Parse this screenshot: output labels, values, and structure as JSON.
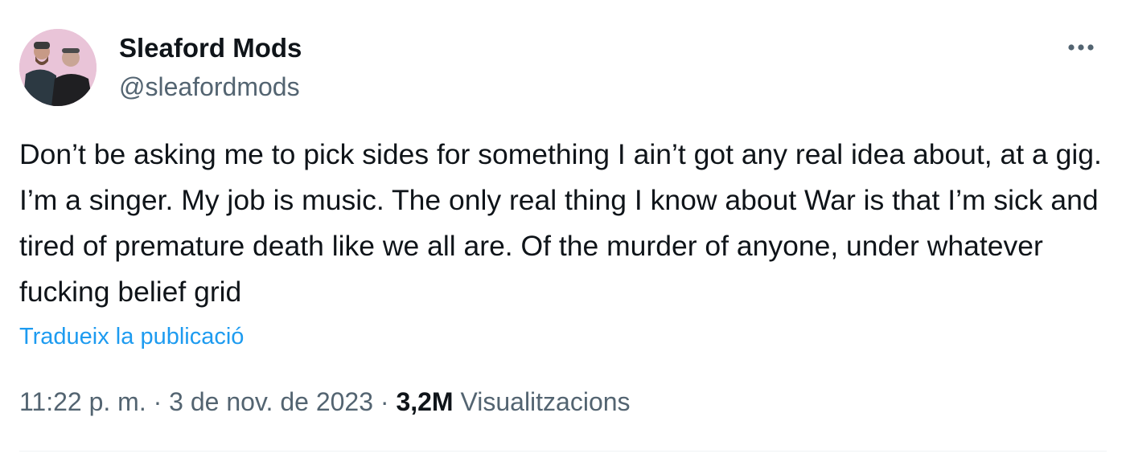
{
  "author": {
    "display_name": "Sleaford Mods",
    "handle": "@sleafordmods",
    "avatar_icon": "band-photo-avatar"
  },
  "menu": {
    "icon": "more-horizontal-icon"
  },
  "tweet": {
    "text": "Don’t be asking me to pick sides for something I ain’t got any real idea about, at a gig. I’m a singer. My job is music. The only real thing I know about War is that I’m sick and tired of premature death like we all are. Of the murder of anyone, under whatever fucking belief grid",
    "translate_label": "Tradueix la publicació"
  },
  "meta": {
    "time": "11:22 p. m.",
    "separator": " · ",
    "date": "3 de nov. de 2023",
    "views_count": "3,2M",
    "views_label": "Visualitzacions"
  },
  "colors": {
    "text": "#0f1419",
    "secondary": "#536471",
    "link": "#1d9bf0",
    "divider": "#eff3f4"
  }
}
